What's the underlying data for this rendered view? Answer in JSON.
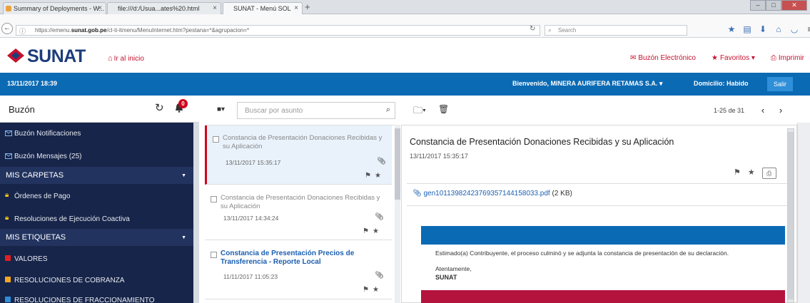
{
  "browser": {
    "tabs": [
      {
        "label": "Summary of Deployments - W...",
        "active": false
      },
      {
        "label": "file:///d:/Usua...ates%20.html",
        "active": false
      },
      {
        "label": "SUNAT - Menú SOL",
        "active": true
      }
    ],
    "url_prefix": "https://emenu.",
    "url_domain": "sunat.gob.pe",
    "url_rest": "/cl-ti-itmenu/MenuInternet.htm?pestana=*&agrupacion=*",
    "search_placeholder": "Search",
    "new_tab": "+"
  },
  "header": {
    "logo": "SUNAT",
    "home_link": "Ir al inicio",
    "buzon_link": "Buzón Electrónico",
    "favoritos_link": "Favoritos",
    "imprimir_link": "Imprimir",
    "brand_blue": "#0b6ab4",
    "brand_red": "#c4122f"
  },
  "bar": {
    "datetime": "13/11/2017 18:39",
    "welcome": "Bienvenido, MINERA AURIFERA RETAMAS S.A.",
    "domicilio": "Domicilio: Habido",
    "salir": "Salir"
  },
  "sidebar": {
    "title": "Buzón",
    "badge": "0",
    "items": [
      {
        "label": "Buzón Notificaciones"
      },
      {
        "label": "Buzón Mensajes (25)"
      }
    ],
    "carpetas_title": "MIS CARPETAS",
    "carpetas": [
      {
        "label": "Órdenes de Pago"
      },
      {
        "label": "Resoluciones de Ejecución Coactiva"
      }
    ],
    "etiquetas_title": "MIS ETIQUETAS",
    "etiquetas": [
      {
        "label": "VALORES",
        "color": "#e02020"
      },
      {
        "label": "RESOLUCIONES DE COBRANZA",
        "color": "#f5a623"
      },
      {
        "label": "RESOLUCIONES DE FRACCIONAMIENTO",
        "color": "#2f8fd8"
      }
    ]
  },
  "list": {
    "search_placeholder": "Buscar por asunto",
    "messages": [
      {
        "subject": "Constancia de Presentación Donaciones Recibidas y su Aplicación",
        "date": "13/11/2017 15:35:17"
      },
      {
        "subject": "Constancia de Presentación Donaciones Recibidas y su Aplicación",
        "date": "13/11/2017 14:34:24"
      },
      {
        "subject": "Constancia de Presentación Precios de Transferencia - Reporte Local",
        "date": "11/11/2017 11:05:23"
      }
    ]
  },
  "reading": {
    "pagination": "1-25 de 31",
    "title": "Constancia de Presentación Donaciones Recibidas y su Aplicación",
    "date": "13/11/2017 15:35:17",
    "attachment_name": "gen10113982423769357144158033.pdf",
    "attachment_size": "(2 KB)",
    "body": "Estimado(a) Contribuyente, el proceso culminó y se adjunta la constancia de presentación de su declaración.",
    "sign1": "Atentamente,",
    "sign2": "SUNAT"
  }
}
